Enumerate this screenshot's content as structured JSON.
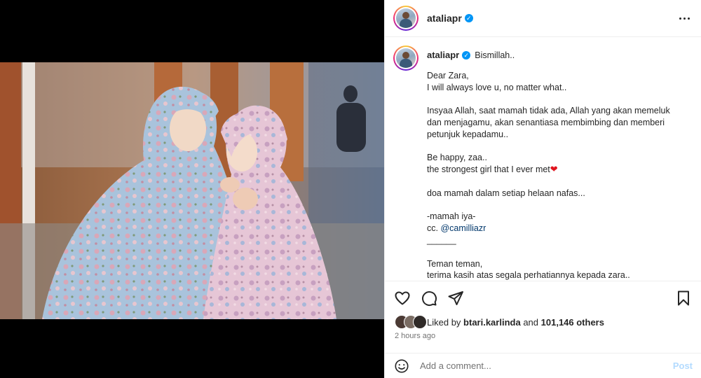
{
  "post": {
    "username": "ataliapr",
    "verified_icon": "verified-badge-icon",
    "more_icon": "more-options-icon"
  },
  "caption": {
    "username": "ataliapr",
    "intro": "Bismillah..",
    "lines": [
      "Dear Zara,",
      "I will always love u, no matter what..",
      "",
      "Insyaa Allah, saat mamah tidak ada, Allah yang akan memeluk",
      "dan menjagamu, akan senantiasa membimbing dan memberi",
      "petunjuk kepadamu..",
      "",
      "Be happy, zaa..",
      "the strongest girl that I ever met",
      "",
      "doa mamah dalam setiap helaan nafas...",
      "",
      "-mamah iya-",
      "cc.",
      "______",
      "",
      "Teman teman,",
      "terima kasih atas segala perhatiannya kepada zara.."
    ],
    "heart": "❤",
    "mention": "@camilliazr"
  },
  "likes": {
    "prefix": "Liked by",
    "liker": "btari.karlinda",
    "and": "and",
    "count": "101,146 others"
  },
  "time_ago": "2 hours ago",
  "comment": {
    "placeholder": "Add a comment...",
    "post_label": "Post"
  },
  "colors": {
    "verified": "#0095f6",
    "heart": "#e0141e",
    "link": "#00376b",
    "post_disabled": "#b3dbff"
  }
}
